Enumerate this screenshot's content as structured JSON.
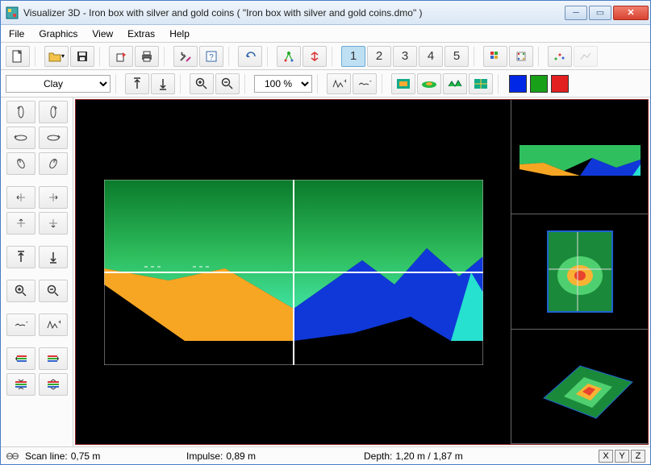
{
  "window": {
    "app_name": "Visualizer 3D",
    "title_suffix": " - Iron box with silver and gold coins ( \"Iron box with silver and gold coins.dmo\" )"
  },
  "menu": {
    "file": "File",
    "graphics": "Graphics",
    "view": "View",
    "extras": "Extras",
    "help": "Help"
  },
  "toolbar1": {
    "numbers": [
      "1",
      "2",
      "3",
      "4",
      "5"
    ],
    "active_view": "1"
  },
  "toolbar2": {
    "soil_type": "Clay",
    "zoom": "100 %"
  },
  "colors": {
    "blue": "#0027e5",
    "green": "#19a019",
    "red": "#e32020"
  },
  "status": {
    "scan_label": "Scan line:",
    "scan_value": "0,75 m",
    "impulse_label": "Impulse:",
    "impulse_value": "0,89 m",
    "depth_label": "Depth:",
    "depth_value": "1,20 m / 1,87 m"
  },
  "axes": [
    "X",
    "Y",
    "Z"
  ]
}
